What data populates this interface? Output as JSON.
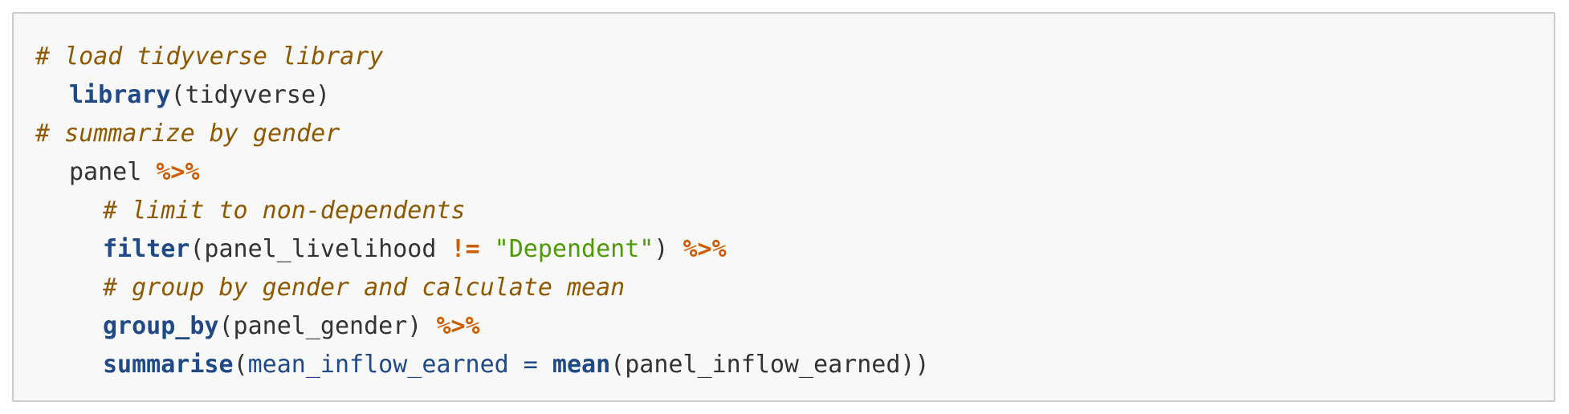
{
  "code": {
    "line1": {
      "comment": "# load tidyverse library"
    },
    "line2": {
      "fn": "library",
      "rest": "(tidyverse)"
    },
    "line3": {
      "comment": "# summarize by gender"
    },
    "line4": {
      "text": "panel ",
      "op": "%>%"
    },
    "line5": {
      "comment": "# limit to non-dependents"
    },
    "line6": {
      "fn": "filter",
      "open": "(panel_livelihood ",
      "op": "!=",
      "space": " ",
      "str": "\"Dependent\"",
      "close": ") ",
      "pipe": "%>%"
    },
    "line7": {
      "comment": "# group by gender and calculate mean"
    },
    "line8": {
      "fn": "group_by",
      "rest": "(panel_gender) ",
      "pipe": "%>%"
    },
    "line9": {
      "fn": "summarise",
      "open": "(",
      "var": "mean_inflow_earned",
      "eq": " = ",
      "fn2": "mean",
      "rest": "(panel_inflow_earned))"
    }
  },
  "colors": {
    "comment": "#8f5902",
    "function": "#204a87",
    "operator": "#ce5c00",
    "string": "#4e9a06",
    "text": "#333333",
    "background": "#f8f8f8",
    "border": "#cccccc"
  }
}
